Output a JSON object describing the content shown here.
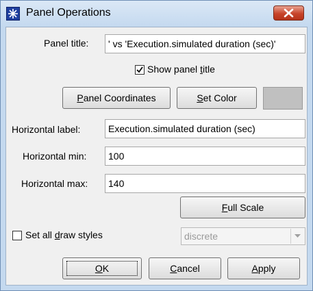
{
  "window": {
    "title": "Panel Operations"
  },
  "panel_title": {
    "label": "Panel title:",
    "value": "' vs 'Execution.simulated duration (sec)'"
  },
  "show_title": {
    "label": "Show panel title",
    "underline_char": "t",
    "checked": true
  },
  "buttons": {
    "panel_coordinates": {
      "label_prefix": "",
      "underline": "P",
      "label_rest": "anel Coordinates"
    },
    "set_color": {
      "label_prefix": "",
      "underline": "S",
      "label_rest": "et Color"
    },
    "full_scale": {
      "label_prefix": "",
      "underline": "F",
      "label_rest": "ull Scale"
    },
    "ok": {
      "label_prefix": "",
      "underline": "O",
      "label_rest": "K"
    },
    "cancel": {
      "label_prefix": "",
      "underline": "C",
      "label_rest": "ancel"
    },
    "apply": {
      "label_prefix": "",
      "underline": "A",
      "label_rest": "pply"
    }
  },
  "color_swatch": {
    "color": "#c0c0c0"
  },
  "horizontal_label": {
    "label": "Horizontal label:",
    "value": "Execution.simulated duration (sec)"
  },
  "horizontal_min": {
    "label": "Horizontal min:",
    "value": "100"
  },
  "horizontal_max": {
    "label": "Horizontal max:",
    "value": "140"
  },
  "draw_styles": {
    "label_prefix": "Set all ",
    "underline": "d",
    "label_rest": "raw styles",
    "checked": false
  },
  "draw_style_select": {
    "value": "discrete",
    "enabled": false
  },
  "colors": {
    "close_button": "#c7442a",
    "title_bar": "#c4d9ef",
    "dialog_bg": "#f0f0f0"
  }
}
